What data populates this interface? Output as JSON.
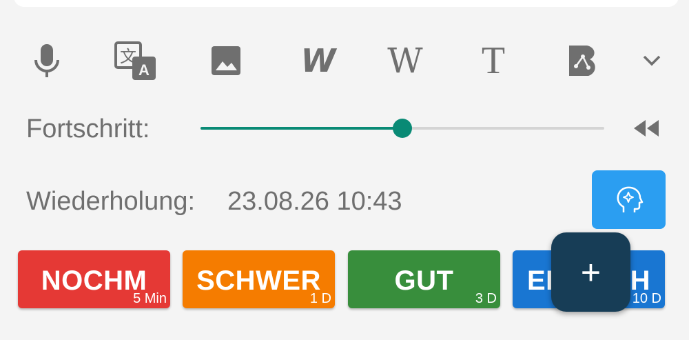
{
  "toolbar": {
    "items": [
      {
        "icon": "microphone-icon"
      },
      {
        "icon": "translate-icon"
      },
      {
        "icon": "image-icon"
      },
      {
        "icon": "wiki-bold-w-icon",
        "glyph": "W"
      },
      {
        "icon": "wikipedia-icon",
        "glyph": "W"
      },
      {
        "icon": "text-icon",
        "glyph": "T"
      },
      {
        "icon": "beolingus-icon"
      },
      {
        "icon": "chevron-down-icon"
      }
    ]
  },
  "progress": {
    "label": "Fortschritt:",
    "value": 0.5,
    "rewind_icon": "rewind-icon"
  },
  "review": {
    "label": "Wiederholung:",
    "date": "23.08.26 10:43",
    "ai_icon": "head-sparkle-icon"
  },
  "answers": [
    {
      "label": "NOCHM",
      "sub": "5 Min",
      "color": "#e53935"
    },
    {
      "label": "SCHWER",
      "sub": "1 D",
      "color": "#f57c00"
    },
    {
      "label": "GUT",
      "sub": "3 D",
      "color": "#388e3c"
    },
    {
      "label": "EINFACH",
      "sub": "10 D",
      "color": "#1976d2"
    }
  ],
  "fab": {
    "label": "+"
  },
  "colors": {
    "accent": "#098a75",
    "fab": "#173d56",
    "ai_button": "#2b9ef1"
  }
}
